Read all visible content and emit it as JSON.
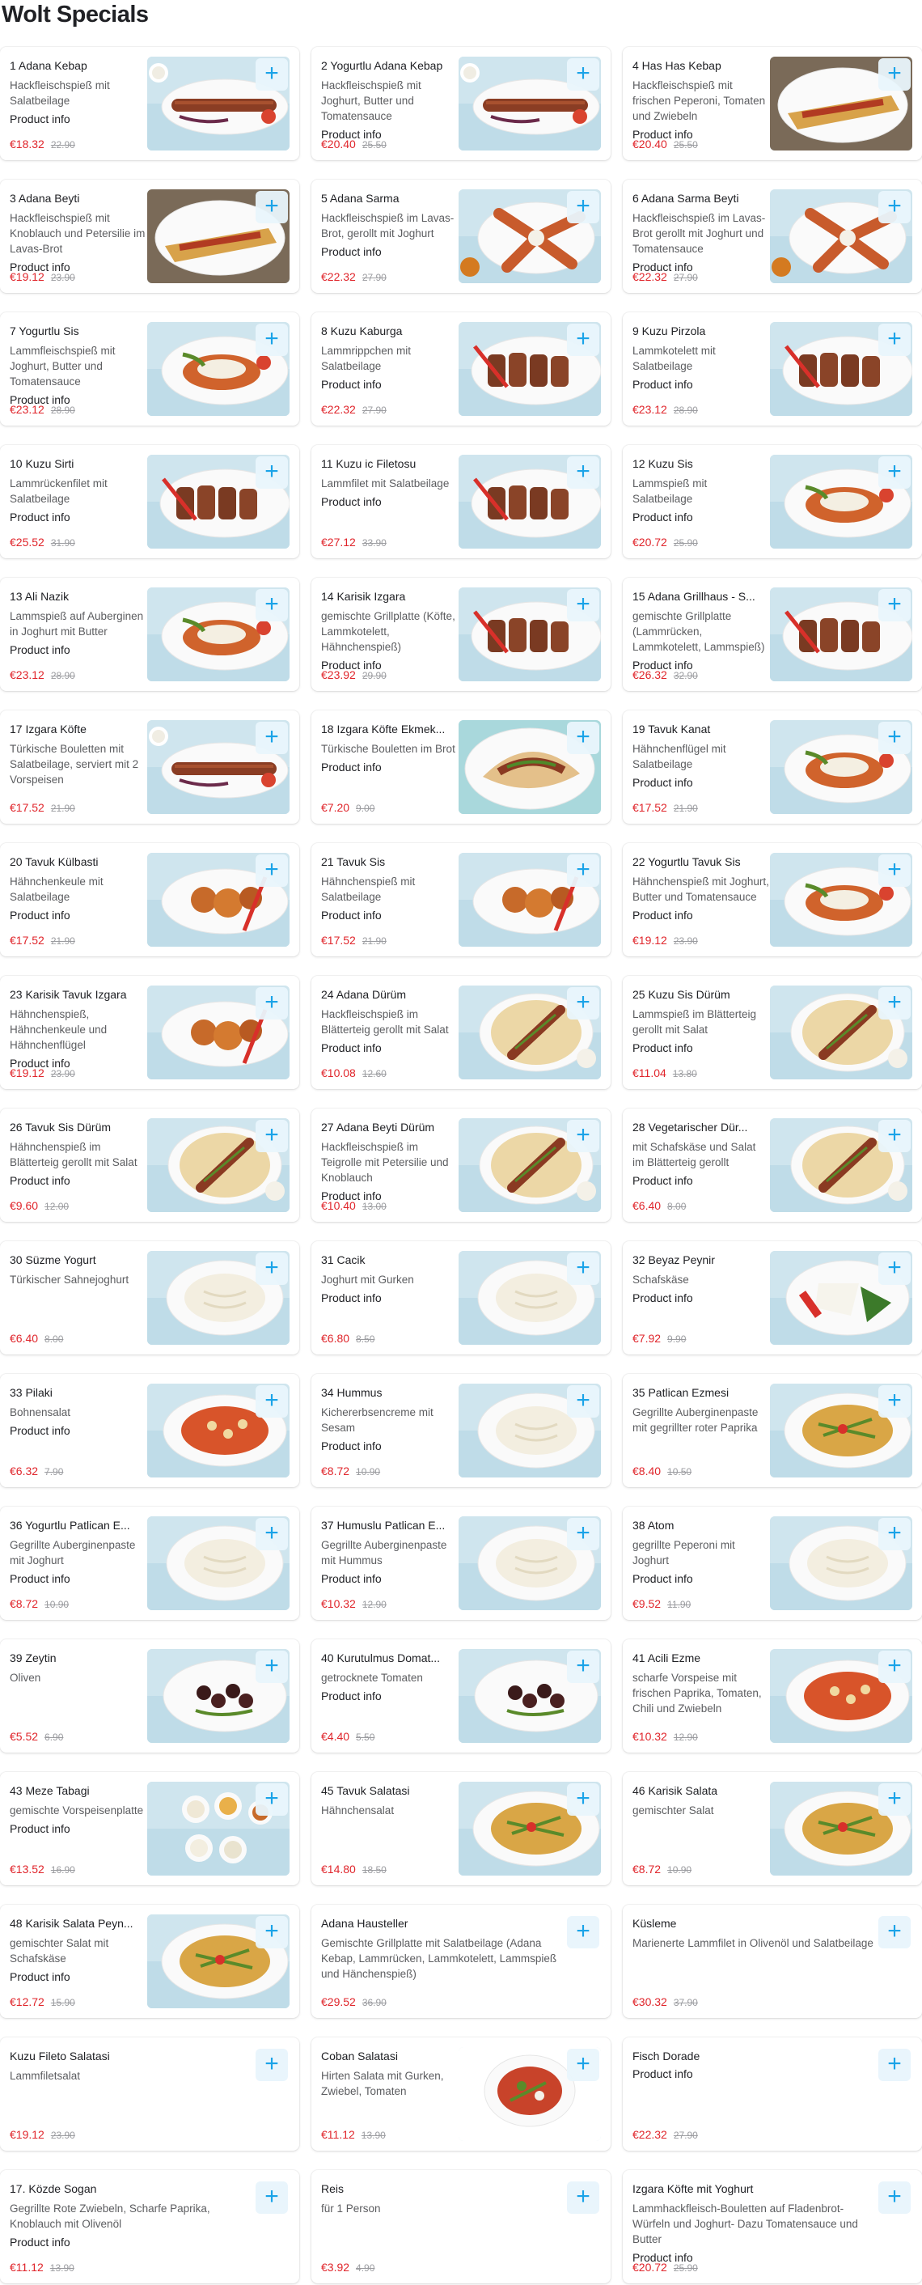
{
  "page": {
    "title": "Wolt Specials"
  },
  "colors": {
    "accent": "#1aa3e8",
    "price": "#e0252b",
    "old_price": "#9b9ca0"
  },
  "plus_icon": "plus-icon",
  "items": [
    {
      "name": "1 Adana Kebap",
      "desc": "Hackfleischspieß mit Salatbeilage",
      "info": "Product info",
      "price": "€18.32",
      "old": "22.90",
      "img": "kebab"
    },
    {
      "name": "2 Yogurtlu Adana Kebap",
      "desc": "Hackfleischspieß mit Joghurt, Butter und Tomatensauce",
      "info": "Product info",
      "price": "€20.40",
      "old": "25.50",
      "img": "kebab"
    },
    {
      "name": "4 Has Has Kebap",
      "desc": "Hackfleischspieß mit frischen Peperoni, Tomaten und Zwiebeln",
      "info": "Product info",
      "price": "€20.40",
      "old": "25.50",
      "img": "pide"
    },
    {
      "name": "3 Adana Beyti",
      "desc": "Hackfleischspieß mit Knoblauch und Petersilie im Lavas-Brot",
      "info": "Product info",
      "price": "€19.12",
      "old": "23.90",
      "img": "pide"
    },
    {
      "name": "5 Adana Sarma",
      "desc": "Hackfleischspieß im Lavas-Brot, gerollt mit Joghurt",
      "info": "Product info",
      "price": "€22.32",
      "old": "27.90",
      "img": "sarma"
    },
    {
      "name": "6 Adana Sarma Beyti",
      "desc": "Hackfleischspieß im Lavas-Brot gerollt mit Joghurt und Tomatensauce",
      "info": "Product info",
      "price": "€22.32",
      "old": "27.90",
      "img": "sarma"
    },
    {
      "name": "7 Yogurtlu Sis",
      "desc": "Lammfleischspieß mit Joghurt, Butter und Tomatensauce",
      "info": "Product info",
      "price": "€23.12",
      "old": "28.90",
      "img": "plate"
    },
    {
      "name": "8 Kuzu Kaburga",
      "desc": "Lammrippchen mit Salatbeilage",
      "info": "Product info",
      "price": "€22.32",
      "old": "27.90",
      "img": "ribs"
    },
    {
      "name": "9 Kuzu Pirzola",
      "desc": "Lammkotelett mit Salatbeilage",
      "info": "Product info",
      "price": "€23.12",
      "old": "28.90",
      "img": "ribs"
    },
    {
      "name": "10 Kuzu Sirti",
      "desc": "Lammrückenfilet mit Salatbeilage",
      "info": "Product info",
      "price": "€25.52",
      "old": "31.90",
      "img": "ribs"
    },
    {
      "name": "11 Kuzu ic Filetosu",
      "desc": "Lammfilet mit Salatbeilage",
      "info": "Product info",
      "price": "€27.12",
      "old": "33.90",
      "img": "ribs"
    },
    {
      "name": "12 Kuzu Sis",
      "desc": "Lammspieß mit Salatbeilage",
      "info": "Product info",
      "price": "€20.72",
      "old": "25.90",
      "img": "plate"
    },
    {
      "name": "13 Ali Nazik",
      "desc": "Lammspieß auf Auberginen in Joghurt mit Butter",
      "info": "Product info",
      "price": "€23.12",
      "old": "28.90",
      "img": "plate"
    },
    {
      "name": "14 Karisik Izgara",
      "desc": "gemischte Grillplatte (Köfte, Lammkotelett, Hähnchenspieß)",
      "info": "Product info",
      "price": "€23.92",
      "old": "29.90",
      "img": "ribs"
    },
    {
      "name": "15 Adana Grillhaus - S...",
      "desc": "gemischte Grillplatte (Lammrücken, Lammkotelett, Lammspieß)",
      "info": "Product info",
      "price": "€26.32",
      "old": "32.90",
      "img": "ribs"
    },
    {
      "name": "17 Izgara Köfte",
      "desc": "Türkische Bouletten mit Salatbeilage, serviert mit 2 Vorspeisen",
      "info": "",
      "price": "€17.52",
      "old": "21.90",
      "img": "kebab"
    },
    {
      "name": "18 Izgara Köfte Ekmek...",
      "desc": "Türkische Bouletten im Brot",
      "info": "Product info",
      "price": "€7.20",
      "old": "9.00",
      "img": "bread"
    },
    {
      "name": "19 Tavuk Kanat",
      "desc": "Hähnchenflügel mit Salatbeilage",
      "info": "Product info",
      "price": "€17.52",
      "old": "21.90",
      "img": "plate"
    },
    {
      "name": "20 Tavuk Külbasti",
      "desc": "Hähnchenkeule mit Salatbeilage",
      "info": "Product info",
      "price": "€17.52",
      "old": "21.90",
      "img": "chicken"
    },
    {
      "name": "21 Tavuk Sis",
      "desc": "Hähnchenspieß mit Salatbeilage",
      "info": "Product info",
      "price": "€17.52",
      "old": "21.90",
      "img": "chicken"
    },
    {
      "name": "22 Yogurtlu Tavuk Sis",
      "desc": "Hähnchenspieß mit Joghurt, Butter und Tomatensauce",
      "info": "Product info",
      "price": "€19.12",
      "old": "23.90",
      "img": "plate"
    },
    {
      "name": "23 Karisik Tavuk Izgara",
      "desc": "Hähnchenspieß, Hähnchenkeule und Hähnchenflügel",
      "info": "Product info",
      "price": "€19.12",
      "old": "23.90",
      "img": "chicken"
    },
    {
      "name": "24 Adana Dürüm",
      "desc": "Hackfleischspieß im Blätterteig gerollt mit Salat",
      "info": "Product info",
      "price": "€10.08",
      "old": "12.60",
      "img": "wrap"
    },
    {
      "name": "25 Kuzu Sis Dürüm",
      "desc": "Lammspieß im Blätterteig gerollt mit Salat",
      "info": "Product info",
      "price": "€11.04",
      "old": "13.80",
      "img": "wrap"
    },
    {
      "name": "26 Tavuk Sis Dürüm",
      "desc": "Hähnchenspieß im Blätterteig gerollt mit Salat",
      "info": "Product info",
      "price": "€9.60",
      "old": "12.00",
      "img": "wrap"
    },
    {
      "name": "27 Adana Beyti Dürüm",
      "desc": "Hackfleischspieß im Teigrolle mit Petersilie und Knoblauch",
      "info": "Product info",
      "price": "€10.40",
      "old": "13.00",
      "img": "wrap"
    },
    {
      "name": "28 Vegetarischer Dür...",
      "desc": "mit Schafskäse und Salat im Blätterteig gerollt",
      "info": "Product info",
      "price": "€6.40",
      "old": "8.00",
      "img": "wrap"
    },
    {
      "name": "30 Süzme Yogurt",
      "desc": "Türkischer Sahnejoghurt",
      "info": "",
      "price": "€6.40",
      "old": "8.00",
      "img": "dip"
    },
    {
      "name": "31 Cacik",
      "desc": "Joghurt mit Gurken",
      "info": "Product info",
      "price": "€6.80",
      "old": "8.50",
      "img": "dip"
    },
    {
      "name": "32 Beyaz Peynir",
      "desc": "Schafskäse",
      "info": "Product info",
      "price": "€7.92",
      "old": "9.90",
      "img": "cheese"
    },
    {
      "name": "33 Pilaki",
      "desc": "Bohnensalat",
      "info": "Product info",
      "price": "€6.32",
      "old": "7.90",
      "img": "beans"
    },
    {
      "name": "34 Hummus",
      "desc": "Kichererbsencreme mit Sesam",
      "info": "Product info",
      "price": "€8.72",
      "old": "10.90",
      "img": "dip"
    },
    {
      "name": "35 Patlican Ezmesi",
      "desc": "Gegrillte Auberginenpaste mit gegrillter roter Paprika",
      "info": "",
      "price": "€8.40",
      "old": "10.50",
      "img": "salad"
    },
    {
      "name": "36 Yogurtlu Patlican E...",
      "desc": "Gegrillte Auberginenpaste mit Joghurt",
      "info": "Product info",
      "price": "€8.72",
      "old": "10.90",
      "img": "dip"
    },
    {
      "name": "37 Humuslu Patlican E...",
      "desc": "Gegrillte Auberginenpaste mit Hummus",
      "info": "Product info",
      "price": "€10.32",
      "old": "12.90",
      "img": "dip"
    },
    {
      "name": "38 Atom",
      "desc": "gegrillte Peperoni mit Joghurt",
      "info": "Product info",
      "price": "€9.52",
      "old": "11.90",
      "img": "dip"
    },
    {
      "name": "39 Zeytin",
      "desc": "Oliven",
      "info": "",
      "price": "€5.52",
      "old": "6.90",
      "img": "olives"
    },
    {
      "name": "40 Kurutulmus Domat...",
      "desc": "getrocknete Tomaten",
      "info": "Product info",
      "price": "€4.40",
      "old": "5.50",
      "img": "olives"
    },
    {
      "name": "41 Acili Ezme",
      "desc": "scharfe Vorspeise mit frischen Paprika, Tomaten, Chili und Zwiebeln",
      "info": "",
      "price": "€10.32",
      "old": "12.90",
      "img": "beans"
    },
    {
      "name": "43 Meze Tabagi",
      "desc": "gemischte Vorspeisenplatte",
      "info": "Product info",
      "price": "€13.52",
      "old": "16.90",
      "img": "meze"
    },
    {
      "name": "45 Tavuk Salatasi",
      "desc": "Hähnchensalat",
      "info": "",
      "price": "€14.80",
      "old": "18.50",
      "img": "salad"
    },
    {
      "name": "46 Karisik Salata",
      "desc": "gemischter Salat",
      "info": "",
      "price": "€8.72",
      "old": "10.90",
      "img": "salad"
    },
    {
      "name": "48 Karisik Salata Peyn...",
      "desc": "gemischter Salat mit Schafskäse",
      "info": "Product info",
      "price": "€12.72",
      "old": "15.90",
      "img": "salad"
    },
    {
      "name": "Adana Hausteller",
      "desc": "Gemischte Grillplatte mit Salatbeilage (Adana Kebap, Lammrücken, Lammkotelett, Lammspieß und Hänchenspieß)",
      "info": "",
      "price": "€29.52",
      "old": "36.90",
      "img": ""
    },
    {
      "name": "Küsleme",
      "desc": "Marienerte Lammfilet in Olivenöl und Salatbeilage",
      "info": "",
      "price": "€30.32",
      "old": "37.90",
      "img": ""
    },
    {
      "name": "Kuzu Fileto Salatasi",
      "desc": "Lammfiletsalat",
      "info": "",
      "price": "€19.12",
      "old": "23.90",
      "img": ""
    },
    {
      "name": "Coban Salatasi",
      "desc": "Hirten Salata mit Gurken, Zwiebel, Tomaten",
      "info": "",
      "price": "€11.12",
      "old": "13.90",
      "img": "coban"
    },
    {
      "name": "Fisch Dorade",
      "desc": "",
      "info": "Product info",
      "price": "€22.32",
      "old": "27.90",
      "img": ""
    },
    {
      "name": "17. Közde Sogan",
      "desc": "Gegrillte Rote Zwiebeln, Scharfe Paprika, Knoblauch mit Olivenöl",
      "info": "Product info",
      "price": "€11.12",
      "old": "13.90",
      "img": ""
    },
    {
      "name": "Reis",
      "desc": "für 1 Person",
      "info": "",
      "price": "€3.92",
      "old": "4.90",
      "img": ""
    },
    {
      "name": "Izgara Köfte mit Yoghurt",
      "desc": "Lammhackfleisch-Bouletten auf Fladenbrot-Würfeln und Joghurt- Dazu Tomatensauce und Butter",
      "info": "Product info",
      "price": "€20.72",
      "old": "25.90",
      "img": ""
    }
  ]
}
